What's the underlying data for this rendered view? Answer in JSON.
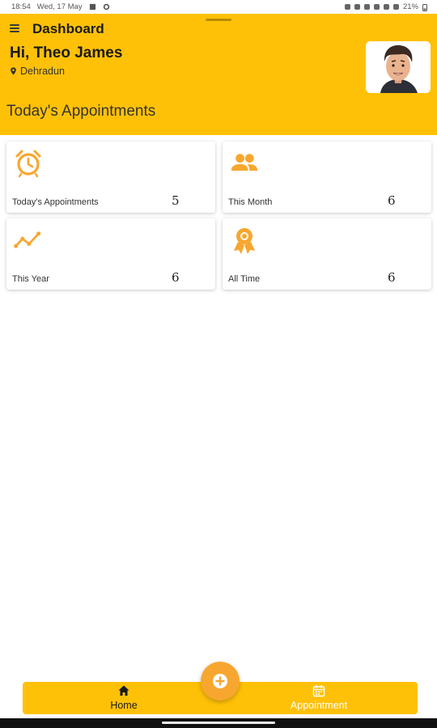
{
  "status_bar": {
    "time": "18:54",
    "date": "Wed, 17 May",
    "battery": "21%"
  },
  "header": {
    "title": "Dashboard",
    "greeting": "Hi, Theo James",
    "location": "Dehradun",
    "section_title": "Today's Appointments",
    "background_color": "#ffc107"
  },
  "cards": [
    {
      "label": "Today's Appointments",
      "value": "5",
      "icon": "alarm-clock-icon"
    },
    {
      "label": "This Month",
      "value": "6",
      "icon": "people-icon"
    },
    {
      "label": "This Year",
      "value": "6",
      "icon": "trending-line-icon"
    },
    {
      "label": "All Time",
      "value": "6",
      "icon": "award-ribbon-icon"
    }
  ],
  "bottom_nav": {
    "items": [
      {
        "label": "Home",
        "icon": "home-icon"
      },
      {
        "label": "Appointment",
        "icon": "calendar-icon"
      }
    ],
    "fab_icon": "add-circle-icon",
    "accent_color": "#f7a72f"
  }
}
